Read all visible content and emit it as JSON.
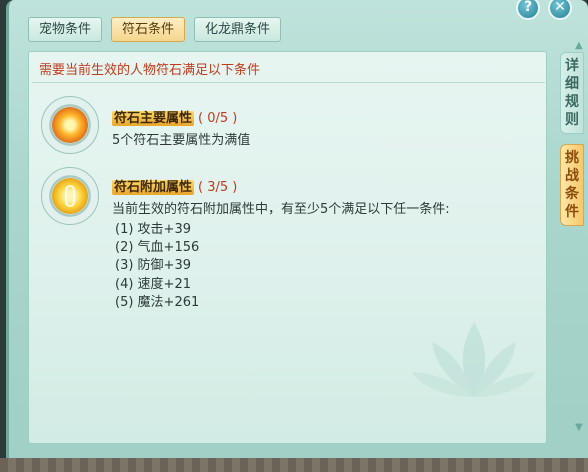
{
  "top_buttons": {
    "help": "?",
    "close": "✕"
  },
  "tabs": [
    {
      "label": "宠物条件",
      "active": false
    },
    {
      "label": "符石条件",
      "active": true
    },
    {
      "label": "化龙鼎条件",
      "active": false
    }
  ],
  "header": {
    "text": "需要当前生效的人物符石满足以下条件"
  },
  "conditions": [
    {
      "icon": "fire-orb-icon",
      "title": "符石主要属性",
      "progress": "( 0/5 )",
      "desc": "5个符石主要属性为满值"
    },
    {
      "icon": "gold-coin-icon",
      "title": "符石附加属性",
      "progress": "( 3/5 )",
      "desc": "当前生效的符石附加属性中，有至少5个满足以下任一条件:",
      "items": [
        "(1) 攻击+39",
        "(2) 气血+156",
        "(3) 防御+39",
        "(4) 速度+21",
        "(5) 魔法+261"
      ]
    }
  ],
  "side_tabs": [
    {
      "label": "详细规则",
      "active": false
    },
    {
      "label": "挑战条件",
      "active": true
    }
  ],
  "colors": {
    "accent_red": "#c43a1c",
    "panel_bg": "#e7f5f1",
    "active_tab": "#f4d58c"
  }
}
